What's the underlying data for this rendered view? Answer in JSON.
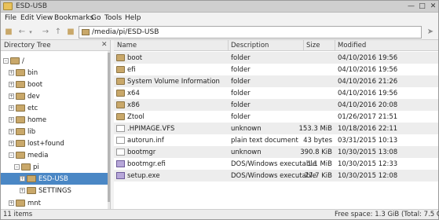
{
  "window": {
    "title": "ESD-USB"
  },
  "menubar": {
    "items": [
      "File",
      "Edit",
      "View",
      "Bookmarks",
      "Go",
      "Tools",
      "Help"
    ]
  },
  "toolbar": {
    "path": "/media/pi/ESD-USB"
  },
  "sidebar": {
    "header": "Directory Tree",
    "items": [
      {
        "label": "/"
      },
      {
        "label": "bin"
      },
      {
        "label": "boot"
      },
      {
        "label": "dev"
      },
      {
        "label": "etc"
      },
      {
        "label": "home"
      },
      {
        "label": "lib"
      },
      {
        "label": "lost+found"
      },
      {
        "label": "media"
      },
      {
        "label": "pi"
      },
      {
        "label": "ESD-USB"
      },
      {
        "label": "SETTINGS"
      },
      {
        "label": "mnt"
      }
    ]
  },
  "columns": {
    "name": "Name",
    "description": "Description",
    "size": "Size",
    "modified": "Modified"
  },
  "files": [
    {
      "name": "boot",
      "description": "folder",
      "size": "",
      "modified": "04/10/2016 19:56",
      "icon": "folder-icon"
    },
    {
      "name": "efi",
      "description": "folder",
      "size": "",
      "modified": "04/10/2016 19:56",
      "icon": "folder-icon"
    },
    {
      "name": "System Volume Information",
      "description": "folder",
      "size": "",
      "modified": "04/10/2016 21:26",
      "icon": "folder-icon"
    },
    {
      "name": "x64",
      "description": "folder",
      "size": "",
      "modified": "04/10/2016 19:56",
      "icon": "folder-icon"
    },
    {
      "name": "x86",
      "description": "folder",
      "size": "",
      "modified": "04/10/2016 20:08",
      "icon": "folder-icon"
    },
    {
      "name": "Ztool",
      "description": "folder",
      "size": "",
      "modified": "01/26/2017 21:51",
      "icon": "folder-icon"
    },
    {
      "name": ".HPIMAGE.VFS",
      "description": "unknown",
      "size": "153.3 MiB",
      "modified": "10/18/2016 22:11",
      "icon": "file-icon"
    },
    {
      "name": "autorun.inf",
      "description": "plain text document",
      "size": "43 bytes",
      "modified": "03/31/2015 10:13",
      "icon": "file-icon"
    },
    {
      "name": "bootmgr",
      "description": "unknown",
      "size": "390.8 KiB",
      "modified": "10/30/2015 13:08",
      "icon": "file-icon"
    },
    {
      "name": "bootmgr.efi",
      "description": "DOS/Windows executable",
      "size": "1.1 MiB",
      "modified": "10/30/2015 12:33",
      "icon": "exe-icon"
    },
    {
      "name": "setup.exe",
      "description": "DOS/Windows executable",
      "size": "77.7 KiB",
      "modified": "10/30/2015 12:08",
      "icon": "exe-icon"
    }
  ],
  "status": {
    "items": "11 items",
    "free_space": "Free space: 1.3 GiB (Total: 7.5 GiB)"
  },
  "colors": {
    "selection": "#4a87c5",
    "folder": "#c9a86a"
  }
}
